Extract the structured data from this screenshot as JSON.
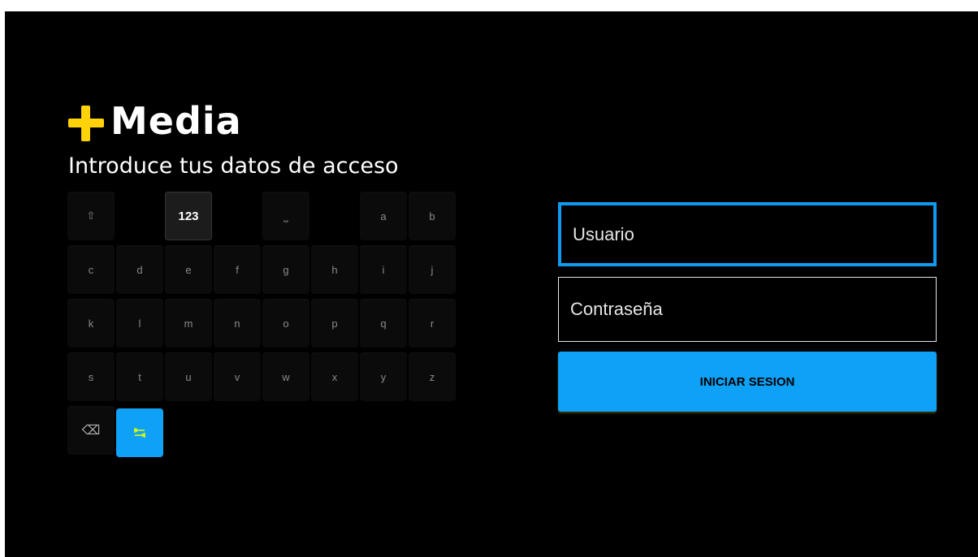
{
  "brand": {
    "name": "Media",
    "accent_color": "#ffd20a"
  },
  "subtitle": "Introduce tus datos de acceso",
  "keyboard": {
    "row1": [
      "⇧",
      "",
      "123",
      "",
      "⎵",
      "",
      "a",
      "b"
    ],
    "row2": [
      "c",
      "d",
      "e",
      "f",
      "g",
      "h",
      "i",
      "j"
    ],
    "row3": [
      "k",
      "l",
      "m",
      "n",
      "o",
      "p",
      "q",
      "r"
    ],
    "row4": [
      "s",
      "t",
      "u",
      "v",
      "w",
      "x",
      "y",
      "z"
    ],
    "row5": [
      "⌫",
      "⭾"
    ],
    "focused_key": "123",
    "active_key_color": "#0fa1f5"
  },
  "form": {
    "user_placeholder": "Usuario",
    "pass_placeholder": "Contraseña",
    "login_label": "INICIAR SESION",
    "focus_color": "#0f9af0"
  }
}
